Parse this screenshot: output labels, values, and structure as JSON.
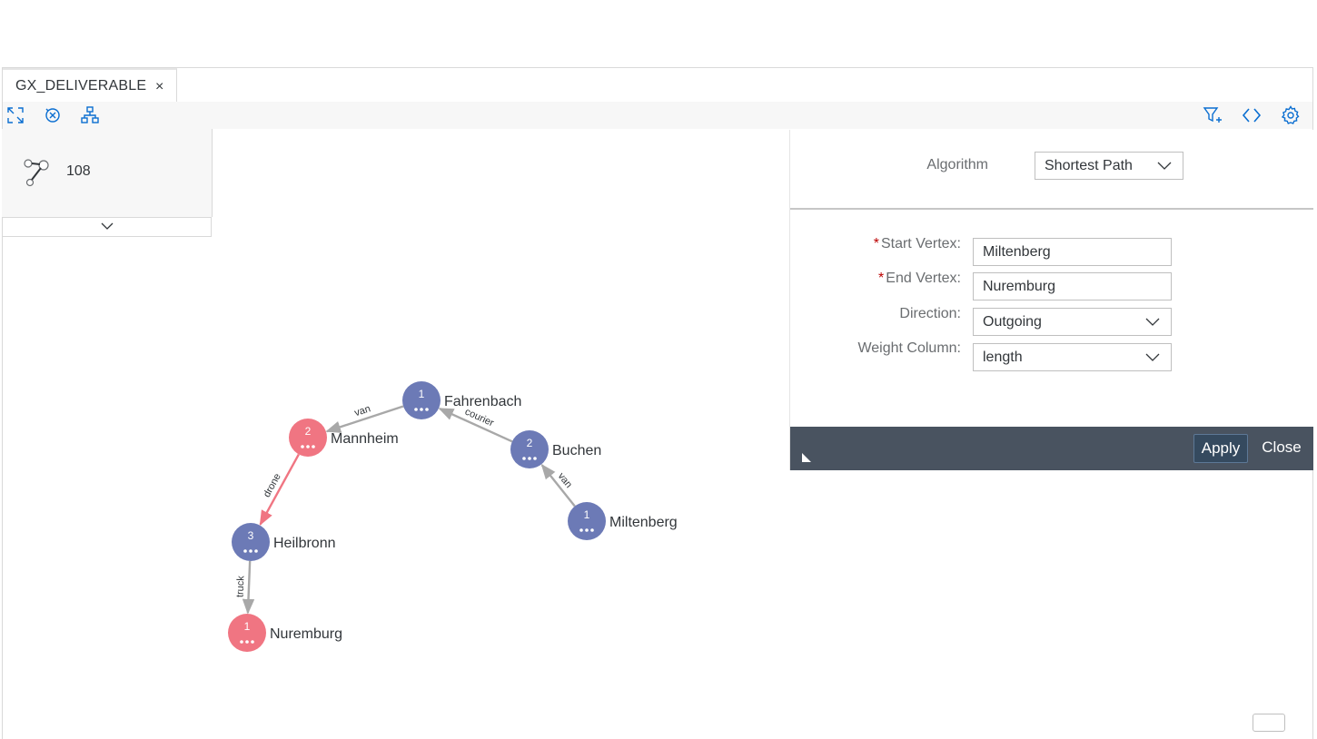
{
  "tab": {
    "label": "GX_DELIVERABLE",
    "close": "×"
  },
  "toolbar": {
    "left_icons": [
      "expand-icon",
      "clear-filter-icon",
      "hierarchy-icon"
    ],
    "right_icons": [
      "filter-add-icon",
      "code-icon",
      "gear-icon"
    ]
  },
  "summary": {
    "icon": "edge-icon",
    "count": "108"
  },
  "graph": {
    "nodes": [
      {
        "name": "Fahrenbach",
        "badge": "1",
        "color": "#6c7ab6"
      },
      {
        "name": "Mannheim",
        "badge": "2",
        "color": "#f07582"
      },
      {
        "name": "Buchen",
        "badge": "2",
        "color": "#6c7ab6"
      },
      {
        "name": "Heilbronn",
        "badge": "3",
        "color": "#6c7ab6"
      },
      {
        "name": "Miltenberg",
        "badge": "1",
        "color": "#6c7ab6"
      },
      {
        "name": "Nuremburg",
        "badge": "1",
        "color": "#f07582"
      }
    ],
    "edges": [
      {
        "from": "Fahrenbach",
        "to": "Mannheim",
        "label": "van"
      },
      {
        "from": "Buchen",
        "to": "Fahrenbach",
        "label": "courier"
      },
      {
        "from": "Miltenberg",
        "to": "Buchen",
        "label": "van"
      },
      {
        "from": "Mannheim",
        "to": "Heilbronn",
        "label": "drone",
        "highlight": true
      },
      {
        "from": "Heilbronn",
        "to": "Nuremburg",
        "label": "truck"
      }
    ],
    "edge_color": "#a8a8a8",
    "highlight_color": "#f07582"
  },
  "panel": {
    "algorithm_label": "Algorithm",
    "algorithm_value": "Shortest Path",
    "start_label": "Start Vertex:",
    "start_value": "Miltenberg",
    "end_label": "End Vertex:",
    "end_value": "Nuremburg",
    "direction_label": "Direction:",
    "direction_value": "Outgoing",
    "weight_label": "Weight Column:",
    "weight_value": "length",
    "required_mark": "*",
    "apply_label": "Apply",
    "close_label": "Close"
  }
}
